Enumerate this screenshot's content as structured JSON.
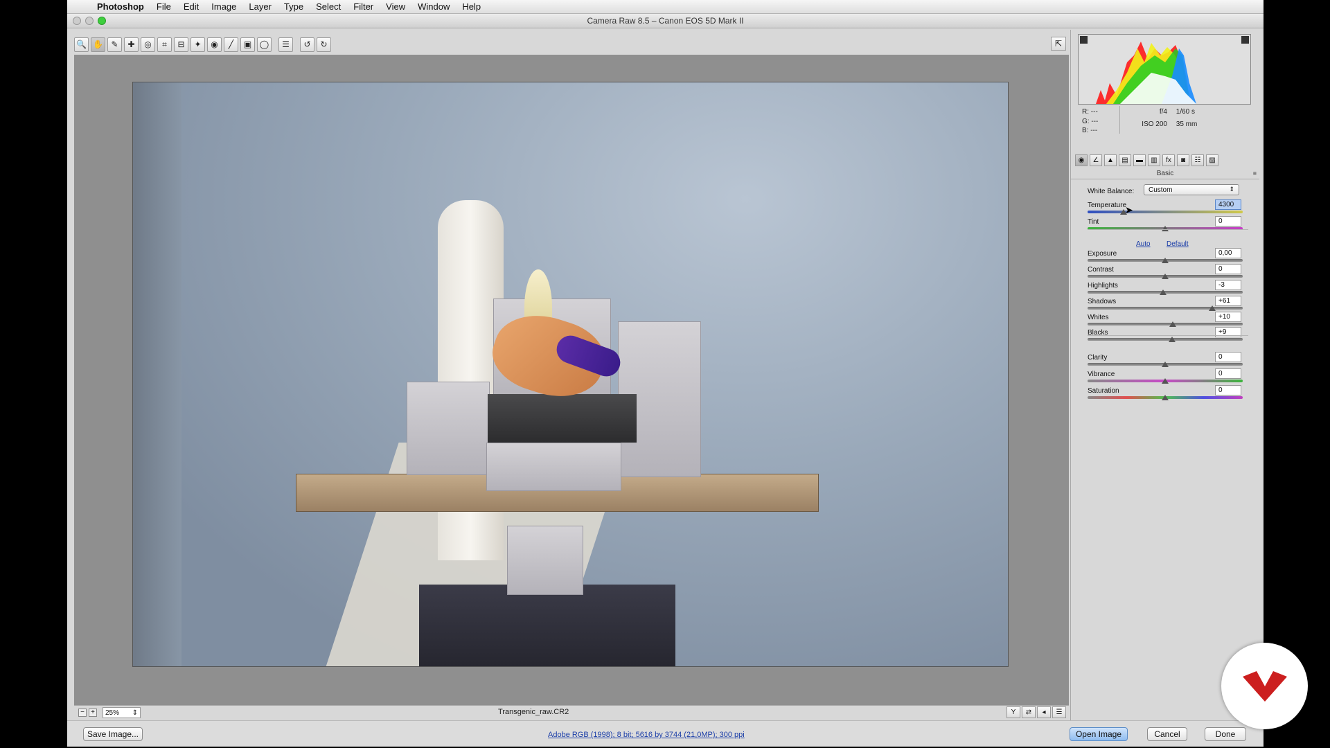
{
  "menubar": {
    "app": "Photoshop",
    "items": [
      "File",
      "Edit",
      "Image",
      "Layer",
      "Type",
      "Select",
      "Filter",
      "View",
      "Window",
      "Help"
    ]
  },
  "window": {
    "title": "Camera Raw 8.5  –  Canon EOS 5D Mark II"
  },
  "toolbar": {
    "tools": [
      {
        "name": "zoom-tool-icon",
        "glyph": "🔍"
      },
      {
        "name": "hand-tool-icon",
        "glyph": "✋"
      },
      {
        "name": "white-balance-tool-icon",
        "glyph": "✎"
      },
      {
        "name": "color-sampler-tool-icon",
        "glyph": "✚"
      },
      {
        "name": "targeted-adjustment-tool-icon",
        "glyph": "◎"
      },
      {
        "name": "crop-tool-icon",
        "glyph": "⌗"
      },
      {
        "name": "straighten-tool-icon",
        "glyph": "⊟"
      },
      {
        "name": "spot-removal-tool-icon",
        "glyph": "✦"
      },
      {
        "name": "red-eye-removal-icon",
        "glyph": "◉"
      },
      {
        "name": "adjustment-brush-icon",
        "glyph": "╱"
      },
      {
        "name": "graduated-filter-icon",
        "glyph": "▣"
      },
      {
        "name": "radial-filter-icon",
        "glyph": "◯"
      },
      {
        "name": "preferences-icon",
        "glyph": "☰"
      },
      {
        "name": "rotate-left-icon",
        "glyph": "↺"
      },
      {
        "name": "rotate-right-icon",
        "glyph": "↻"
      }
    ]
  },
  "preview": {
    "zoom": "25%",
    "filename": "Transgenic_raw.CR2"
  },
  "bottombar": {
    "save_image": "Save Image...",
    "workflow": "Adobe RGB (1998); 8 bit; 5616 by 3744 (21,0MP); 300 ppi",
    "open_image": "Open Image",
    "cancel": "Cancel",
    "done": "Done"
  },
  "readout": {
    "r": "R:   ---",
    "g": "G:   ---",
    "b": "B:   ---",
    "aperture": "f/4",
    "shutter": "1/60 s",
    "iso": "ISO 200",
    "focal": "35 mm"
  },
  "panel": {
    "title": "Basic",
    "white_balance_label": "White Balance:",
    "white_balance_value": "Custom",
    "auto": "Auto",
    "default": "Default",
    "sliders": {
      "temperature": {
        "label": "Temperature",
        "value": "4300",
        "pos": 0.23
      },
      "tint": {
        "label": "Tint",
        "value": "0",
        "pos": 0.5
      },
      "exposure": {
        "label": "Exposure",
        "value": "0,00",
        "pos": 0.5
      },
      "contrast": {
        "label": "Contrast",
        "value": "0",
        "pos": 0.5
      },
      "highlights": {
        "label": "Highlights",
        "value": "-3",
        "pos": 0.485
      },
      "shadows": {
        "label": "Shadows",
        "value": "+61",
        "pos": 0.805
      },
      "whites": {
        "label": "Whites",
        "value": "+10",
        "pos": 0.55
      },
      "blacks": {
        "label": "Blacks",
        "value": "+9",
        "pos": 0.545
      },
      "clarity": {
        "label": "Clarity",
        "value": "0",
        "pos": 0.5
      },
      "vibrance": {
        "label": "Vibrance",
        "value": "0",
        "pos": 0.5
      },
      "saturation": {
        "label": "Saturation",
        "value": "0",
        "pos": 0.5
      }
    }
  },
  "colors": {
    "primary_button": "#8fbdf0",
    "link": "#1a3da8",
    "logo_red": "#cc1f1f"
  }
}
